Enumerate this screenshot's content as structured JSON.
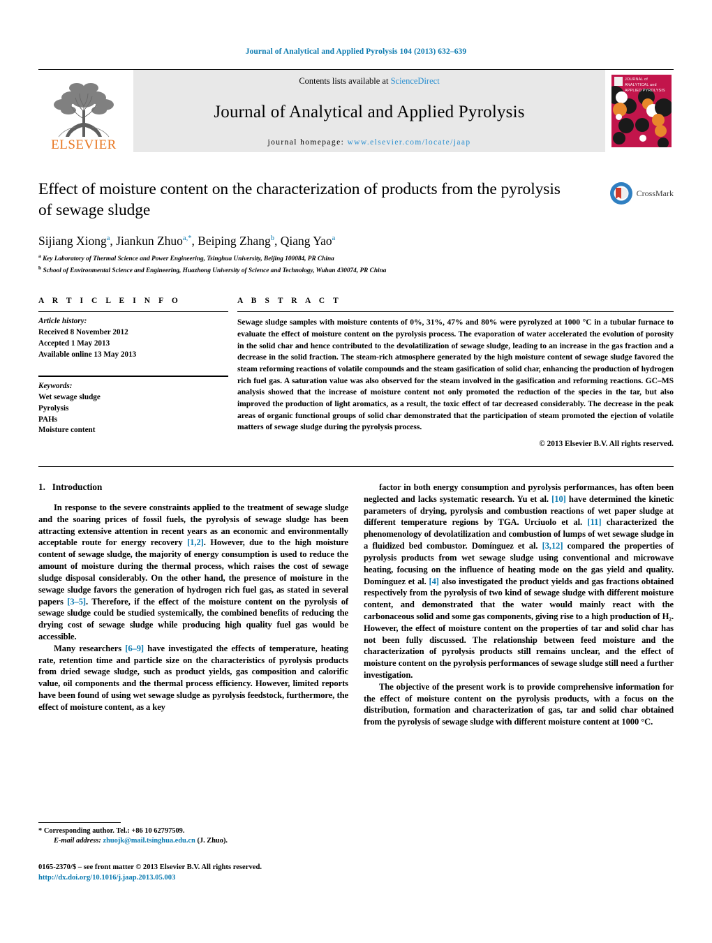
{
  "running_head": "Journal of Analytical and Applied Pyrolysis 104 (2013) 632–639",
  "masthead": {
    "publisher_name": "ELSEVIER",
    "contents_prefix": "Contents lists available at ",
    "contents_link": "ScienceDirect",
    "journal_title": "Journal of Analytical and Applied Pyrolysis",
    "homepage_prefix": "journal homepage: ",
    "homepage_url": "www.elsevier.com/locate/jaap",
    "cover_line1": "JOURNAL of",
    "cover_line2": "ANALYTICAL and",
    "cover_line3": "APPLIED PYROLYSIS",
    "cover_color": "#c2154b",
    "accent_color": "#0b7ab0",
    "link_color": "#2a8fd0",
    "elsevier_orange": "#e87722"
  },
  "article": {
    "title": "Effect of moisture content on the characterization of products from the pyrolysis of sewage sludge",
    "crossmark_label": "CrossMark",
    "authors": [
      {
        "name": "Sijiang Xiong",
        "sup": "a"
      },
      {
        "name": "Jiankun Zhuo",
        "sup": "a,*"
      },
      {
        "name": "Beiping Zhang",
        "sup": "b"
      },
      {
        "name": "Qiang Yao",
        "sup": "a"
      }
    ],
    "affiliations": [
      {
        "mark": "a",
        "text": "Key Laboratory of Thermal Science and Power Engineering, Tsinghua University, Beijing 100084, PR China"
      },
      {
        "mark": "b",
        "text": "School of Environmental Science and Engineering, Huazhong University of Science and Technology, Wuhan 430074, PR China"
      }
    ]
  },
  "article_info": {
    "heading": "A R T I C L E  I N F O",
    "history_label": "Article history:",
    "history": [
      "Received 8 November 2012",
      "Accepted 1 May 2013",
      "Available online 13 May 2013"
    ],
    "keywords_label": "Keywords:",
    "keywords": [
      "Wet sewage sludge",
      "Pyrolysis",
      "PAHs",
      "Moisture content"
    ]
  },
  "abstract": {
    "heading": "A B S T R A C T",
    "text": "Sewage sludge samples with moisture contents of 0%, 31%, 47% and 80% were pyrolyzed at 1000 °C in a tubular furnace to evaluate the effect of moisture content on the pyrolysis process. The evaporation of water accelerated the evolution of porosity in the solid char and hence contributed to the devolatilization of sewage sludge, leading to an increase in the gas fraction and a decrease in the solid fraction. The steam-rich atmosphere generated by the high moisture content of sewage sludge favored the steam reforming reactions of volatile compounds and the steam gasification of solid char, enhancing the production of hydrogen rich fuel gas. A saturation value was also observed for the steam involved in the gasification and reforming reactions. GC–MS analysis showed that the increase of moisture content not only promoted the reduction of the species in the tar, but also improved the production of light aromatics, as a result, the toxic effect of tar decreased considerably. The decrease in the peak areas of organic functional groups of solid char demonstrated that the participation of steam promoted the ejection of volatile matters of sewage sludge during the pyrolysis process.",
    "copyright": "© 2013 Elsevier B.V. All rights reserved."
  },
  "introduction": {
    "section_number": "1.",
    "section_title": "Introduction",
    "left_paragraphs": [
      {
        "segments": [
          {
            "t": "In response to the severe constraints applied to the treatment of sewage sludge and the soaring prices of fossil fuels, the pyrolysis of sewage sludge has been attracting extensive attention in recent years as an economic and environmentally acceptable route for energy recovery "
          },
          {
            "t": "[1,2]",
            "link": true
          },
          {
            "t": ". However, due to the high moisture content of sewage sludge, the majority of energy consumption is used to reduce the amount of moisture during the thermal process, which raises the cost of sewage sludge disposal considerably. On the other hand, the presence of moisture in the sewage sludge favors the generation of hydrogen rich fuel gas, as stated in several papers "
          },
          {
            "t": "[3–5]",
            "link": true
          },
          {
            "t": ". Therefore, if the effect of the moisture content on the pyrolysis of sewage sludge could be studied systemically, the combined benefits of reducing the drying cost of sewage sludge while producing high quality fuel gas would be accessible."
          }
        ]
      },
      {
        "segments": [
          {
            "t": "Many researchers "
          },
          {
            "t": "[6–9]",
            "link": true
          },
          {
            "t": " have investigated the effects of temperature, heating rate, retention time and particle size on the characteristics of pyrolysis products from dried sewage sludge, such as product yields, gas composition and calorific value, oil components and the thermal process efficiency. However, limited reports have been found of using wet sewage sludge as pyrolysis feedstock, furthermore, the effect of moisture content, as a key"
          }
        ]
      }
    ],
    "right_paragraphs": [
      {
        "segments": [
          {
            "t": "factor in both energy consumption and pyrolysis performances, has often been neglected and lacks systematic research. Yu et al. "
          },
          {
            "t": "[10]",
            "link": true
          },
          {
            "t": " have determined the kinetic parameters of drying, pyrolysis and combustion reactions of wet paper sludge at different temperature regions by TGA. Urciuolo et al. "
          },
          {
            "t": "[11]",
            "link": true
          },
          {
            "t": " characterized the phenomenology of devolatilization and combustion of lumps of wet sewage sludge in a fluidized bed combustor. Domínguez et al. "
          },
          {
            "t": "[3,12]",
            "link": true
          },
          {
            "t": " compared the properties of pyrolysis products from wet sewage sludge using conventional and microwave heating, focusing on the influence of heating mode on the gas yield and quality. Domínguez et al. "
          },
          {
            "t": "[4]",
            "link": true
          },
          {
            "t": " also investigated the product yields and gas fractions obtained respectively from the pyrolysis of two kind of sewage sludge with different moisture content, and demonstrated that the water would mainly react with the carbonaceous solid and some gas components, giving rise to a high production of H₂. However, the effect of moisture content on the properties of tar and solid char has not been fully discussed. The relationship between feed moisture and the characterization of pyrolysis products still remains unclear, and the effect of moisture content on the pyrolysis performances of sewage sludge still need a further investigation."
          }
        ]
      },
      {
        "segments": [
          {
            "t": "The objective of the present work is to provide comprehensive information for the effect of moisture content on the pyrolysis products, with a focus on the distribution, formation and characterization of gas, tar and solid char obtained from the pyrolysis of sewage sludge with different moisture content at 1000 °C."
          }
        ]
      }
    ]
  },
  "footer": {
    "corresponding_marker": "*",
    "corresponding_text": "Corresponding author. Tel.: +86 10 62797509.",
    "email_label": "E-mail address:",
    "email": "zhuojk@mail.tsinghua.edu.cn",
    "email_suffix": "(J. Zhuo).",
    "issn_line": "0165-2370/$ – see front matter © 2013 Elsevier B.V. All rights reserved.",
    "doi": "http://dx.doi.org/10.1016/j.jaap.2013.05.003"
  }
}
